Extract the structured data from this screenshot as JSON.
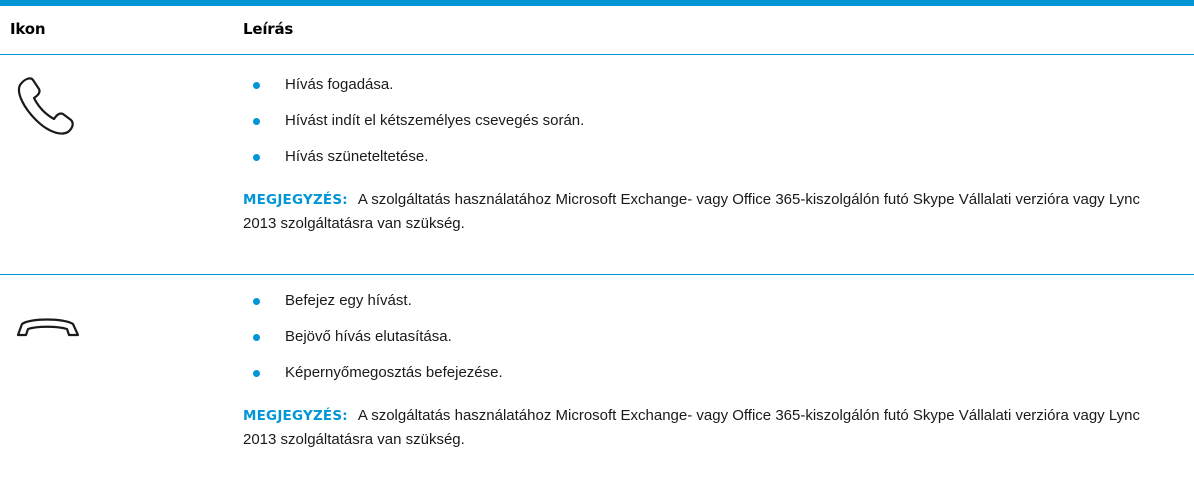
{
  "table": {
    "header": {
      "icon_col": "Ikon",
      "desc_col": "Leírás"
    },
    "rows": [
      {
        "icon": "phone-answer-icon",
        "bullets": [
          "Hívás fogadása.",
          "Hívást indít el kétszemélyes csevegés során.",
          "Hívás szüneteltetése."
        ],
        "note_label": "MEGJEGYZÉS:",
        "note_text": "A szolgáltatás használatához Microsoft Exchange- vagy Office 365-kiszolgálón futó Skype Vállalati verzióra vagy Lync 2013 szolgáltatásra van szükség."
      },
      {
        "icon": "phone-hangup-icon",
        "bullets": [
          "Befejez egy hívást.",
          "Bejövő hívás elutasítása.",
          "Képernyőmegosztás befejezése."
        ],
        "note_label": "MEGJEGYZÉS:",
        "note_text": "A szolgáltatás használatához Microsoft Exchange- vagy Office 365-kiszolgálón futó Skype Vállalati verzióra vagy Lync 2013 szolgáltatásra van szükség."
      }
    ]
  },
  "colors": {
    "accent": "#0096d6",
    "text": "#1a1a1a"
  }
}
